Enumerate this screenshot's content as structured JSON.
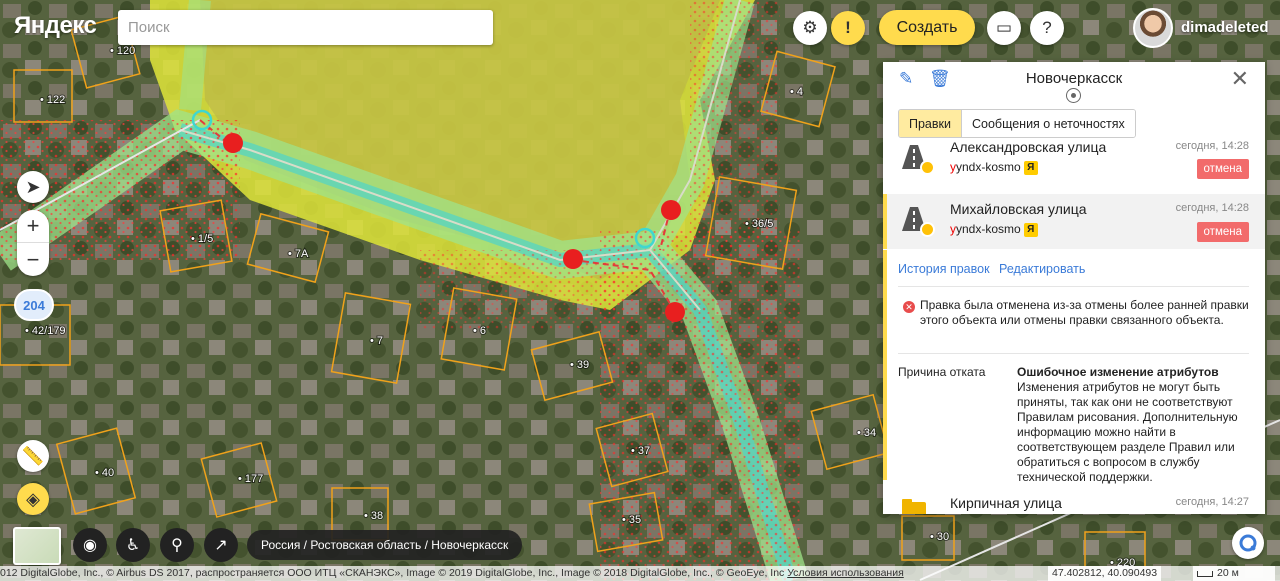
{
  "header": {
    "logo": "Яндекс",
    "search_placeholder": "Поиск",
    "create_label": "Создать",
    "username": "dimadeleted",
    "settings_icon": "gear-icon",
    "alert_icon": "exclamation-icon",
    "chat_icon": "chat-icon",
    "help_icon": "question-icon"
  },
  "map": {
    "layers_badge": "204",
    "building_labels": [
      "120",
      "122",
      "1/5",
      "7А",
      "42/179",
      "7",
      "6",
      "39",
      "40",
      "177",
      "38",
      "37",
      "35",
      "4",
      "36/5",
      "34",
      "30",
      "220"
    ],
    "breadcrumb": "Россия / Ростовская область / Новочеркасск",
    "copyright": "012 DigitalGlobe, Inc., © Airbus DS 2017, распространяется ООО ИТЦ «СКАНЭКС», Image © 2019 DigitalGlobe, Inc., Image © 2018 DigitalGlobe, Inc., © GeoEye, Inc",
    "terms_link": "Условия использования",
    "coords": "47.402812, 40.090493",
    "scale": "20 м"
  },
  "panel": {
    "title": "Новочеркасск",
    "tabs": [
      {
        "label": "Правки",
        "active": true
      },
      {
        "label": "Сообщения о неточностях",
        "active": false
      }
    ],
    "edits": [
      {
        "name": "Александровская улица",
        "user": "yndx-kosmo",
        "time": "сегодня, 14:28",
        "status": "отмена"
      },
      {
        "name": "Михайловская улица",
        "user": "yndx-kosmo",
        "time": "сегодня, 14:28",
        "status": "отмена"
      },
      {
        "name": "Кирпичная улица",
        "user": "",
        "time": "сегодня, 14:27",
        "status": ""
      }
    ],
    "links": {
      "history": "История правок",
      "edit": "Редактировать"
    },
    "message": "Правка была отменена из-за отмены более ранней правки этого объекта или отмены правки связанного объекта.",
    "reason_label": "Причина отката",
    "reason_title": "Ошибочное изменение атрибутов",
    "reason_text": "Изменения атрибутов не могут быть приняты, так как они не соответствуют Правилам рисования. Дополнительную информацию можно найти в соответствующем разделе Правил или обратиться с вопросом в службу технической поддержки."
  }
}
